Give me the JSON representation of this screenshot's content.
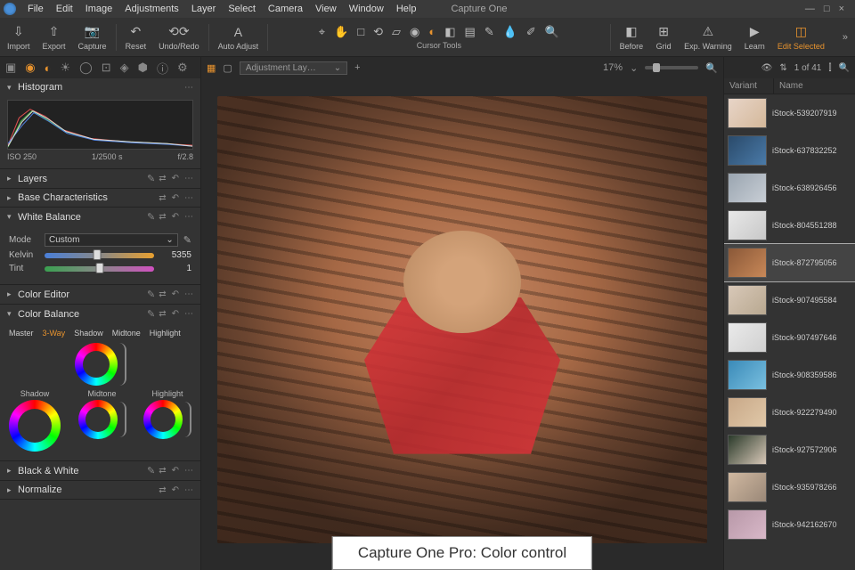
{
  "app_title": "Capture One",
  "menu": [
    "File",
    "Edit",
    "Image",
    "Adjustments",
    "Layer",
    "Select",
    "Camera",
    "View",
    "Window",
    "Help"
  ],
  "toolbar": {
    "import": "Import",
    "export": "Export",
    "capture": "Capture",
    "reset": "Reset",
    "undoredo": "Undo/Redo",
    "autoadjust": "Auto Adjust",
    "cursor_label": "Cursor Tools",
    "before": "Before",
    "grid": "Grid",
    "expwarn": "Exp. Warning",
    "learn": "Learn",
    "editsel": "Edit Selected"
  },
  "histogram": {
    "title": "Histogram",
    "iso": "ISO 250",
    "shutter": "1/2500 s",
    "aperture": "f/2.8"
  },
  "sections": {
    "layers": "Layers",
    "base": "Base Characteristics",
    "coloreditor": "Color Editor",
    "colorbalance": "Color Balance",
    "bw": "Black & White",
    "normalize": "Normalize"
  },
  "whitebalance": {
    "title": "White Balance",
    "mode_label": "Mode",
    "mode_value": "Custom",
    "kelvin_label": "Kelvin",
    "kelvin_value": "5355",
    "tint_label": "Tint",
    "tint_value": "1"
  },
  "colorbalance": {
    "tabs": [
      "Master",
      "3-Way",
      "Shadow",
      "Midtone",
      "Highlight"
    ],
    "active_tab": "3-Way",
    "wheels": {
      "shadow": "Shadow",
      "midtone": "Midtone",
      "highlight": "Highlight"
    }
  },
  "viewer": {
    "layer_dropdown": "Adjustment Lay…",
    "zoom": "17%"
  },
  "browser": {
    "counter": "1 of 41",
    "head_variant": "Variant",
    "head_name": "Name",
    "items": [
      {
        "name": "iStock-539207919",
        "bg": "linear-gradient(135deg,#e8d5c8,#d4b89a)"
      },
      {
        "name": "iStock-637832252",
        "bg": "linear-gradient(135deg,#2a4a6a,#4a7aa8)"
      },
      {
        "name": "iStock-638926456",
        "bg": "linear-gradient(135deg,#9aa5b0,#c8ced5)"
      },
      {
        "name": "iStock-804551288",
        "bg": "linear-gradient(135deg,#e8e8e8,#c8c8c8)"
      },
      {
        "name": "iStock-872795056",
        "bg": "linear-gradient(135deg,#8a5838,#c88858)",
        "selected": true
      },
      {
        "name": "iStock-907495584",
        "bg": "linear-gradient(135deg,#d8c8b8,#b8a890)"
      },
      {
        "name": "iStock-907497646",
        "bg": "linear-gradient(135deg,#eaeaea,#d0d0d0)"
      },
      {
        "name": "iStock-908359586",
        "bg": "linear-gradient(135deg,#3a8ab8,#7ac0e0)"
      },
      {
        "name": "iStock-922279490",
        "bg": "linear-gradient(135deg,#c8a888,#e0c8a8)"
      },
      {
        "name": "iStock-927572906",
        "bg": "linear-gradient(135deg,#2a3a2a,#d8c8b8)"
      },
      {
        "name": "iStock-935978266",
        "bg": "linear-gradient(135deg,#d0b8a0,#9a8878)"
      },
      {
        "name": "iStock-942162670",
        "bg": "linear-gradient(135deg,#b898a8,#d8b8c8)"
      }
    ]
  },
  "caption": "Capture One Pro: Color control"
}
